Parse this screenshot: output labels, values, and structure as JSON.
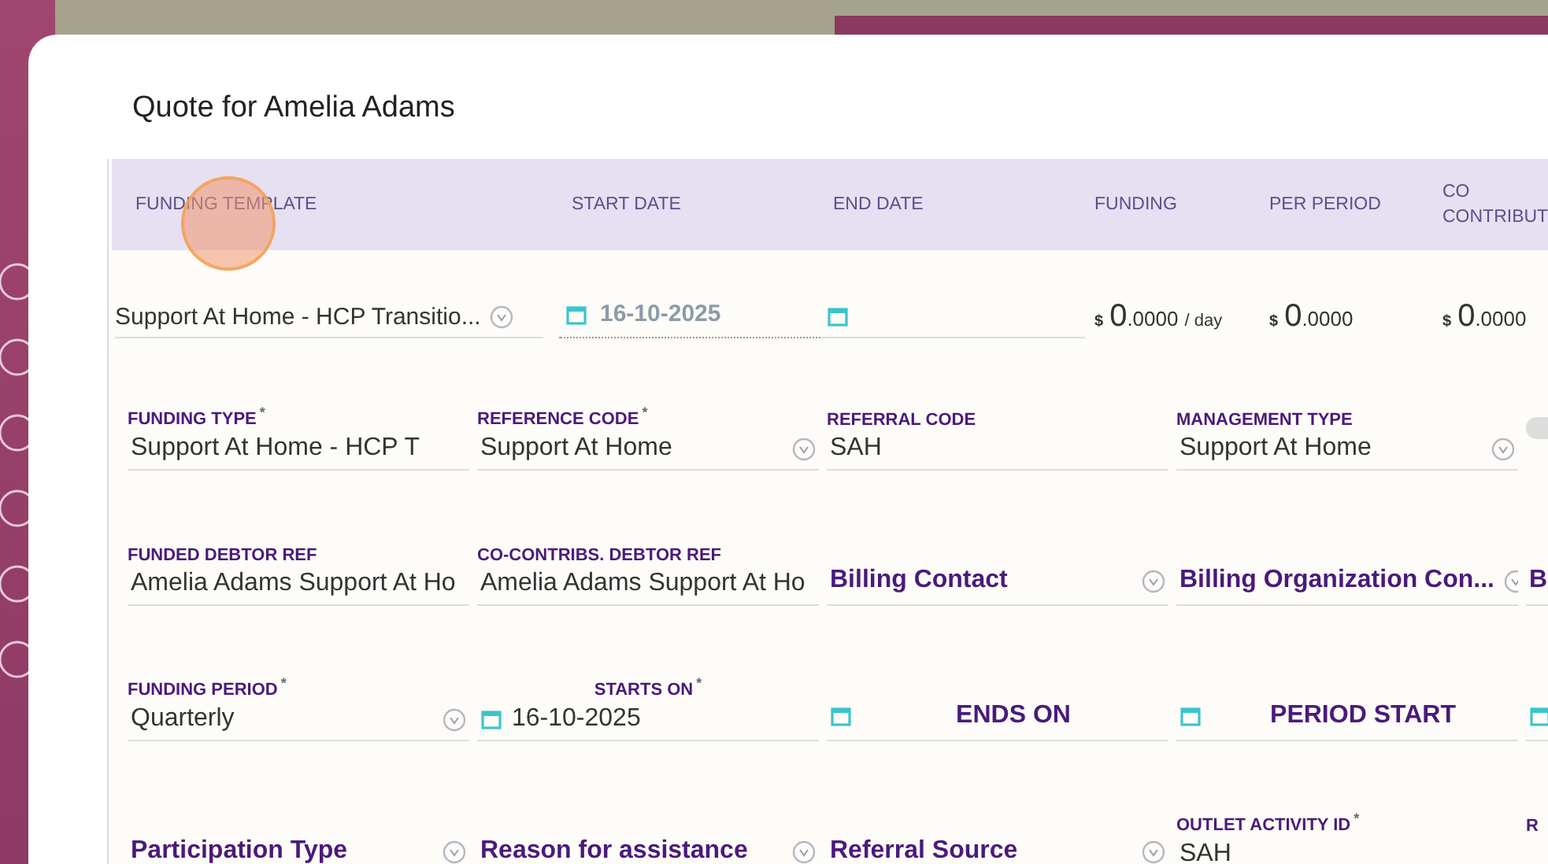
{
  "title": "Quote for Amelia Adams",
  "table": {
    "columns": [
      "FUNDING TEMPLATE",
      "START DATE",
      "END DATE",
      "FUNDING",
      "PER PERIOD",
      "CO CONTRIBUT"
    ],
    "cells": [
      {
        "kind": "select",
        "value": "Support At Home - HCP Transitio..."
      },
      {
        "kind": "date",
        "value": "16-10-2025"
      },
      {
        "kind": "date"
      },
      {
        "kind": "amount",
        "currency": "$",
        "whole": "0",
        "decimals": ".0000",
        "unit": "/ day"
      },
      {
        "kind": "amount",
        "currency": "$",
        "whole": "0",
        "decimals": ".0000"
      },
      {
        "kind": "amount",
        "currency": "$",
        "whole": "0",
        "decimals": ".0000"
      }
    ]
  },
  "form": {
    "rows": [
      [
        {
          "kind": "text",
          "label": "FUNDING TYPE",
          "required_mark": "*",
          "value": "Support At Home - HCP T"
        },
        {
          "kind": "select",
          "label": "REFERENCE CODE",
          "required_mark": "*",
          "value": "Support At Home"
        },
        {
          "kind": "text",
          "label": "REFERRAL CODE",
          "value": "SAH"
        },
        {
          "kind": "select",
          "label": "MANAGEMENT TYPE",
          "value": "Support At Home"
        },
        {
          "kind": "toggle",
          "on": false
        }
      ],
      [
        {
          "kind": "text",
          "label": "FUNDED DEBTOR REF",
          "value": "Amelia Adams Support At Ho"
        },
        {
          "kind": "text",
          "label": "CO-CONTRIBS. DEBTOR REF",
          "value": "Amelia Adams Support At Ho"
        },
        {
          "kind": "select",
          "placeholder": "Billing Contact"
        },
        {
          "kind": "select",
          "placeholder": "Billing Organization Con..."
        },
        {
          "kind": "select",
          "placeholder": "B"
        }
      ],
      [
        {
          "kind": "select",
          "label": "FUNDING PERIOD",
          "required_mark": "*",
          "value": "Quarterly"
        },
        {
          "kind": "date",
          "label": "STARTS ON",
          "required_mark": "*",
          "value": "16-10-2025"
        },
        {
          "kind": "date",
          "placeholder": "ENDS ON"
        },
        {
          "kind": "date",
          "placeholder": "PERIOD START"
        },
        {
          "kind": "date"
        }
      ],
      [
        {
          "kind": "select",
          "placeholder": "Participation Type"
        },
        {
          "kind": "select",
          "placeholder": "Reason for assistance"
        },
        {
          "kind": "select",
          "placeholder": "Referral Source"
        },
        {
          "kind": "text",
          "label": "OUTLET ACTIVITY ID",
          "required_mark": "*",
          "value": "SAH"
        },
        {
          "kind": "text",
          "label": "R"
        }
      ]
    ]
  }
}
